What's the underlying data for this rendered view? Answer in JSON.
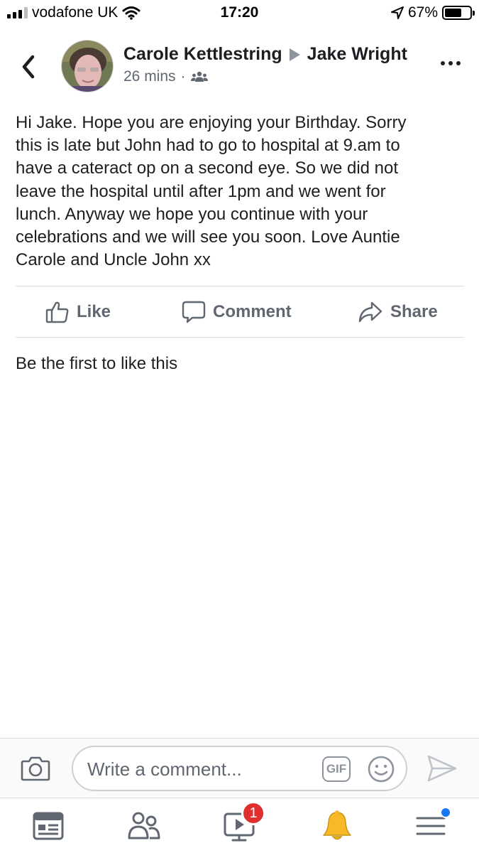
{
  "status_bar": {
    "carrier": "vodafone UK",
    "time": "17:20",
    "battery": "67%",
    "battery_level": 0.67
  },
  "post": {
    "author": "Carole Kettlestring",
    "recipient": "Jake Wright",
    "time": "26 mins",
    "audience_icon": "friends-icon",
    "text": "Hi Jake. Hope you are enjoying your Birthday. Sorry\nthis is late but John had to go to hospital at 9.am to\nhave a cateract op on a second eye. So we did not\nleave the hospital until after 1pm and we went for\nlunch. Anyway we hope you continue with your\ncelebrations and we will see you soon. Love Auntie\nCarole and Uncle John xx"
  },
  "actions": {
    "like": "Like",
    "comment": "Comment",
    "share": "Share"
  },
  "likes_summary": "Be the first to like this",
  "composer": {
    "placeholder": "Write a comment...",
    "gif_label": "GIF"
  },
  "tab_bar": {
    "tabs": [
      "news-feed-icon",
      "friends-icon",
      "watch-icon",
      "notifications-icon",
      "menu-icon"
    ],
    "watch_badge": "1"
  },
  "colors": {
    "text_primary": "#1c1e21",
    "text_secondary": "#606770",
    "icon_gray": "#8d949e",
    "badge_red": "#e02f2f",
    "accent_blue": "#1877f2",
    "bell_yellow": "#f7b928"
  }
}
